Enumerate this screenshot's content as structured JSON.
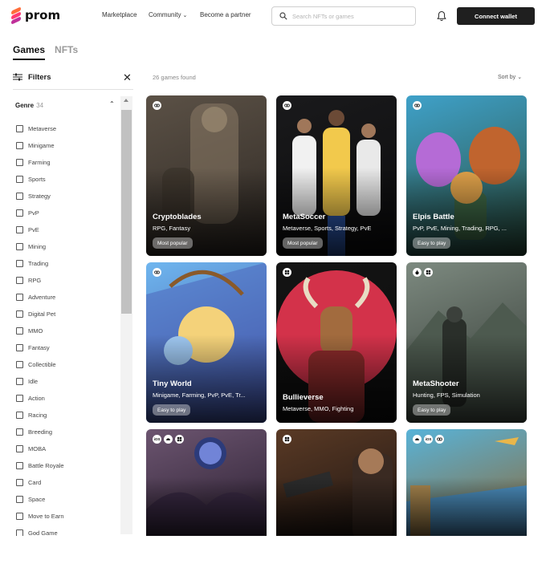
{
  "header": {
    "logo_text": "prom",
    "nav": {
      "marketplace": "Marketplace",
      "community": "Community",
      "partner": "Become a partner"
    },
    "search_placeholder": "Search NFTs or games",
    "connect_label": "Connect wallet"
  },
  "tabs": [
    {
      "label": "Games",
      "active": true
    },
    {
      "label": "NFTs",
      "active": false
    }
  ],
  "filters": {
    "title": "Filters",
    "genre_label": "Genre",
    "genre_count": "34",
    "genres": [
      "Metaverse",
      "Minigame",
      "Farming",
      "Sports",
      "Strategy",
      "PvP",
      "PvE",
      "Mining",
      "Trading",
      "RPG",
      "Adventure",
      "Digital Pet",
      "MMO",
      "Fantasy",
      "Collectible",
      "Idle",
      "Action",
      "Racing",
      "Breeding",
      "MOBA",
      "Battle Royale",
      "Card",
      "Space",
      "Move to Earn",
      "God Game"
    ]
  },
  "results": {
    "count_text": "26 games found",
    "sort_label": "Sort by"
  },
  "games": [
    {
      "title": "Cryptoblades",
      "tags": "RPG, Fantasy",
      "badge": "Most popular",
      "platforms": [
        "web"
      ],
      "colors": [
        "#5b5146",
        "#2e2823"
      ]
    },
    {
      "title": "MetaSoccer",
      "tags": "Metaverse, Sports, Strategy, PvE",
      "badge": "Most popular",
      "platforms": [
        "web"
      ],
      "colors": [
        "#1a1a1c",
        "#0b0b0c"
      ]
    },
    {
      "title": "Elpis Battle",
      "tags": "PvP, PvE, Mining, Trading, RPG, ...",
      "badge": "Easy to play",
      "platforms": [
        "web"
      ],
      "colors": [
        "#3fa1c9",
        "#2a4d3b"
      ]
    },
    {
      "title": "Tiny World",
      "tags": "Minigame, Farming, PvP, PvE, Tr...",
      "badge": "Easy to play",
      "platforms": [
        "web"
      ],
      "colors": [
        "#6fb6ef",
        "#3d4a9a"
      ]
    },
    {
      "title": "Bullieverse",
      "tags": "Metaverse, MMO, Fighting",
      "badge": "",
      "platforms": [
        "windows"
      ],
      "colors": [
        "#141414",
        "#0c0c0c"
      ]
    },
    {
      "title": "MetaShooter",
      "tags": "Hunting, FPS, Simulation",
      "badge": "Easy to play",
      "platforms": [
        "apple",
        "windows"
      ],
      "colors": [
        "#7d8a80",
        "#2f3530"
      ]
    },
    {
      "title": "",
      "tags": "",
      "badge": "",
      "platforms": [
        "ios",
        "android",
        "windows"
      ],
      "colors": [
        "#6c5570",
        "#2b1f31"
      ]
    },
    {
      "title": "",
      "tags": "",
      "badge": "",
      "platforms": [
        "windows"
      ],
      "colors": [
        "#5a3a25",
        "#1e1512"
      ]
    },
    {
      "title": "",
      "tags": "",
      "badge": "",
      "platforms": [
        "android",
        "ios",
        "web"
      ],
      "colors": [
        "#58b3d8",
        "#8c6a3a"
      ]
    }
  ]
}
